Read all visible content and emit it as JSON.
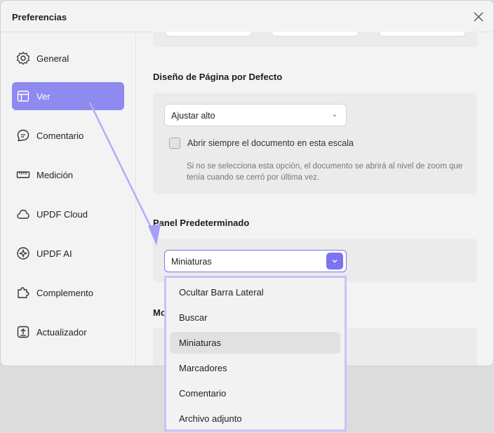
{
  "window": {
    "title": "Preferencias"
  },
  "sidebar": {
    "items": [
      {
        "label": "General",
        "icon": "gear-icon"
      },
      {
        "label": "Ver",
        "icon": "layout-icon",
        "active": true
      },
      {
        "label": "Comentario",
        "icon": "comment-icon"
      },
      {
        "label": "Medición",
        "icon": "ruler-icon"
      },
      {
        "label": "UPDF Cloud",
        "icon": "cloud-icon"
      },
      {
        "label": "UPDF AI",
        "icon": "ai-sparkle-icon"
      },
      {
        "label": "Complemento",
        "icon": "puzzle-icon"
      },
      {
        "label": "Actualizador",
        "icon": "update-icon"
      }
    ]
  },
  "page_layout": {
    "heading": "Diseño de Página por Defecto",
    "select_value": "Ajustar alto",
    "checkbox_label": "Abrir siempre el documento en esta escala",
    "checkbox_checked": false,
    "hint": "Si no se selecciona esta opción, el documento se abrirá al nivel de zoom que tenía cuando se cerró por última vez."
  },
  "panel": {
    "heading": "Panel Predeterminado",
    "select_value": "Miniaturas",
    "options": [
      "Ocultar Barra Lateral",
      "Buscar",
      "Miniaturas",
      "Marcadores",
      "Comentario",
      "Archivo adjunto"
    ],
    "selected": "Miniaturas"
  },
  "next_section": {
    "heading_partial": "Mo"
  },
  "colors": {
    "accent": "#7b73f2",
    "active_nav": "#8f8af0",
    "highlight": "#c9c2f7",
    "arrow": "#b4abf7"
  }
}
